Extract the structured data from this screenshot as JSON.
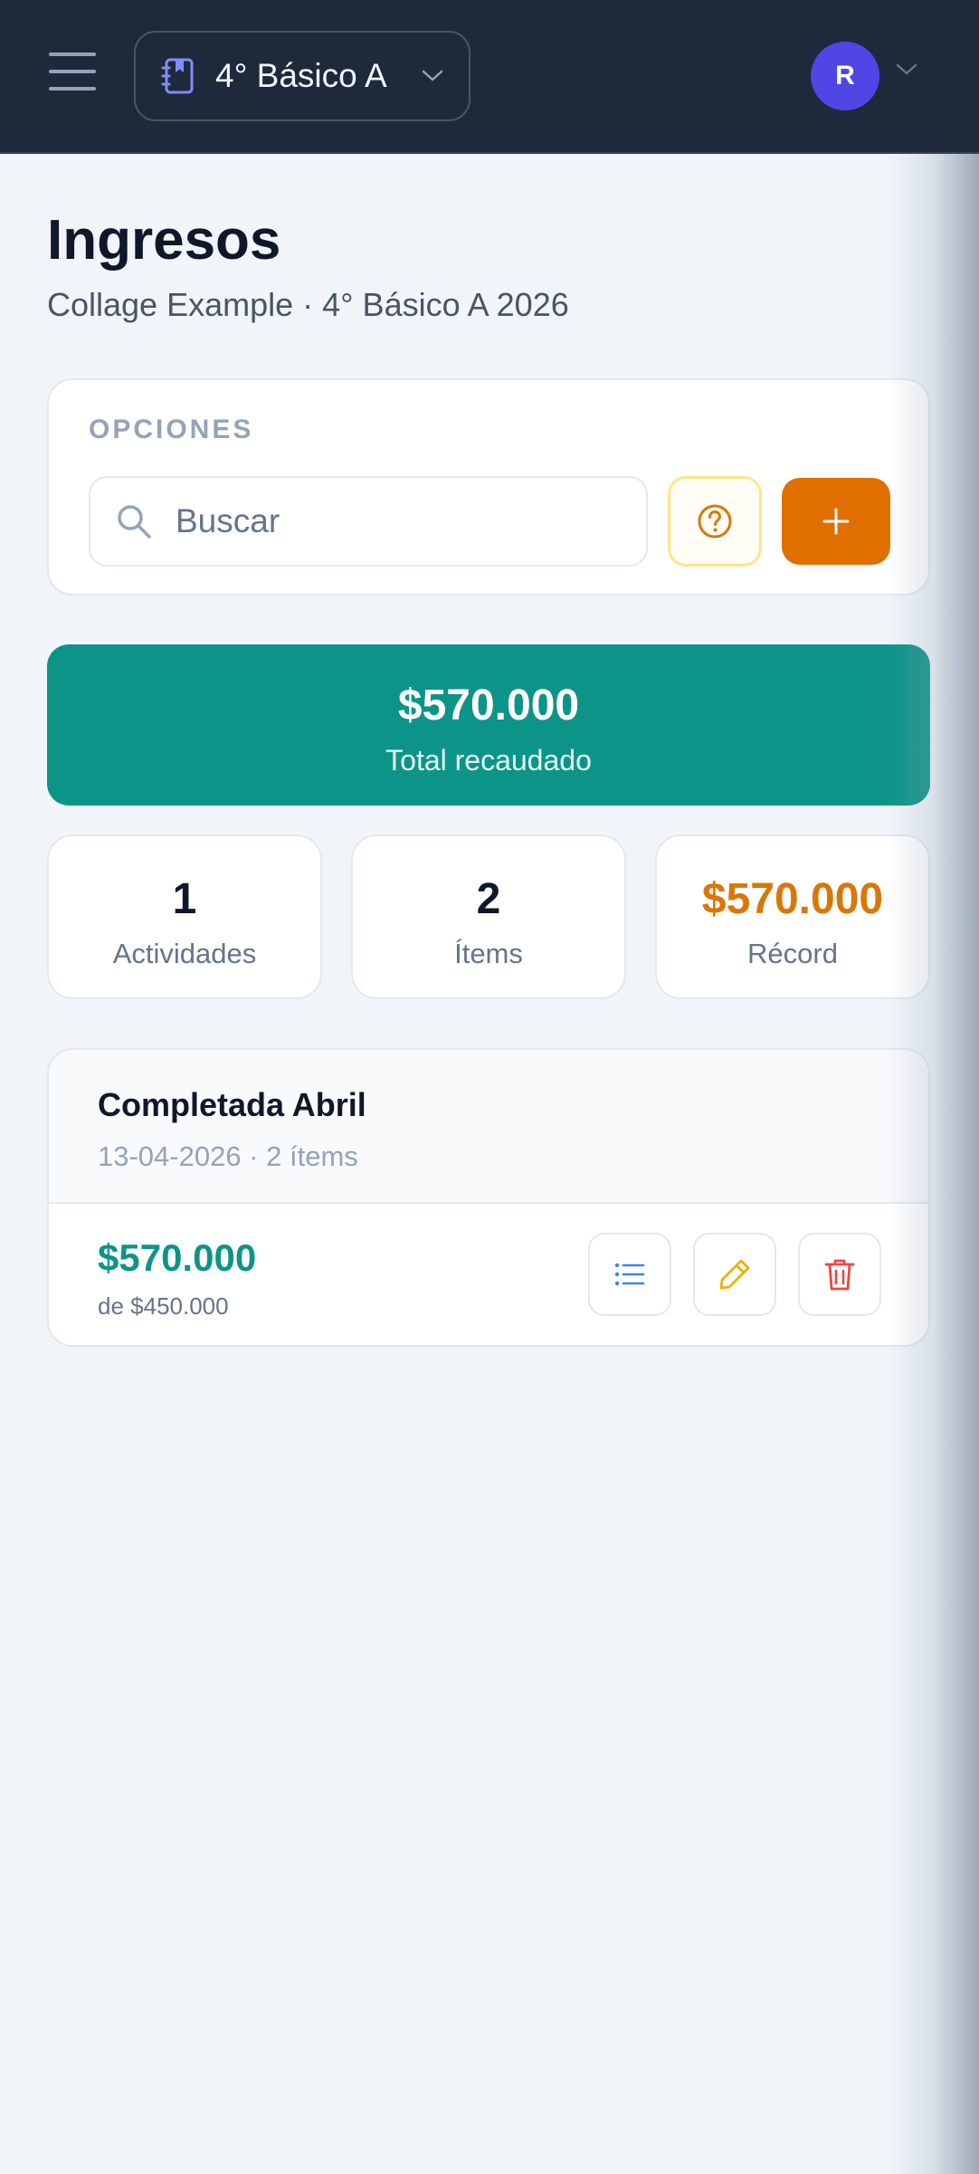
{
  "header": {
    "menu_icon": "hamburger-icon",
    "course_icon": "notebook-icon",
    "course_label": "4° Básico A",
    "avatar_initial": "R"
  },
  "page": {
    "title": "Ingresos",
    "subtitle": "Collage Example · 4° Básico A 2026"
  },
  "options": {
    "label": "OPCIONES",
    "search_placeholder": "Buscar",
    "search_value": ""
  },
  "total": {
    "amount": "$570.000",
    "caption": "Total recaudado"
  },
  "stats": [
    {
      "value": "1",
      "label": "Actividades"
    },
    {
      "value": "2",
      "label": "Ítems"
    },
    {
      "value": "$570.000",
      "label": "Récord"
    }
  ],
  "activity": {
    "name": "Completada Abril",
    "meta": "13-04-2026 · 2 ítems",
    "amount": "$570.000",
    "goal": "de $450.000"
  },
  "colors": {
    "header_bg": "#1e293b",
    "accent_teal": "#0d9488",
    "accent_orange": "#e06f00",
    "avatar": "#4f46e5",
    "record_amber": "#d97706"
  }
}
